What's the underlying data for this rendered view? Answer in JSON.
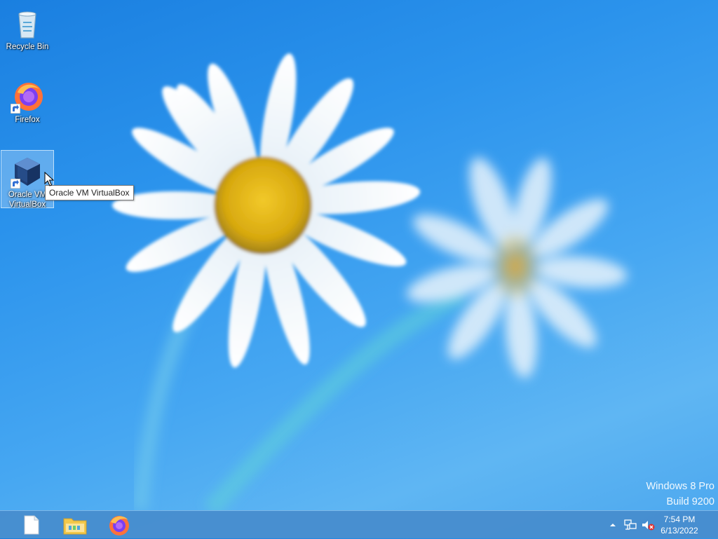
{
  "desktop": {
    "icons": [
      {
        "label": "Recycle Bin",
        "icon": "recycle-bin-icon",
        "shortcut": false
      },
      {
        "label": "Firefox",
        "icon": "firefox-icon",
        "shortcut": true
      },
      {
        "label": "Oracle VM VirtualBox",
        "icon": "virtualbox-icon",
        "shortcut": true,
        "selected": true
      }
    ],
    "tooltip": "Oracle VM VirtualBox",
    "watermark": {
      "line1": "Windows 8 Pro",
      "line2": "Build 9200"
    }
  },
  "taskbar": {
    "pinned": [
      {
        "icon": "blank-document-icon"
      },
      {
        "icon": "file-explorer-icon"
      },
      {
        "icon": "firefox-icon"
      }
    ],
    "tray": {
      "icons": [
        "show-hidden-icons-chevron-icon",
        "network-icon",
        "volume-muted-icon"
      ],
      "time": "7:54 PM",
      "date": "6/13/2022"
    }
  },
  "colors": {
    "taskbar": "#468ccd",
    "wallpaper": "#2b93ec"
  }
}
